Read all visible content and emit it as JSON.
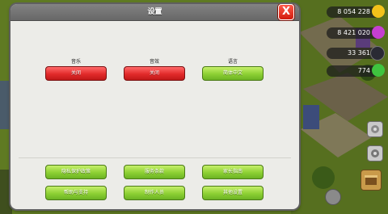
{
  "title": "设置",
  "close_label": "X",
  "toggles": [
    {
      "label": "音乐",
      "state": "关闭",
      "color": "#e22a2a"
    },
    {
      "label": "音效",
      "state": "关闭",
      "color": "#e22a2a"
    },
    {
      "label": "语言",
      "state": "简体中文",
      "color": "#8dd033"
    }
  ],
  "bottom_buttons": [
    [
      "隐私保护政策",
      "服务条款",
      "家长指南"
    ],
    [
      "帮助与支持",
      "制作人员",
      "其他设置"
    ]
  ],
  "hud": {
    "gold": "8 054 228",
    "elixir": "8 421 020",
    "dark_elixir": "33 361",
    "gems": "774"
  },
  "colors": {
    "gold": "#f2c21a",
    "elixir": "#c63fd0",
    "dark": "#2a2a34",
    "gem": "#3fc43f"
  },
  "side_icons": [
    "settings-icon",
    "gear-icon",
    "shop-icon"
  ]
}
